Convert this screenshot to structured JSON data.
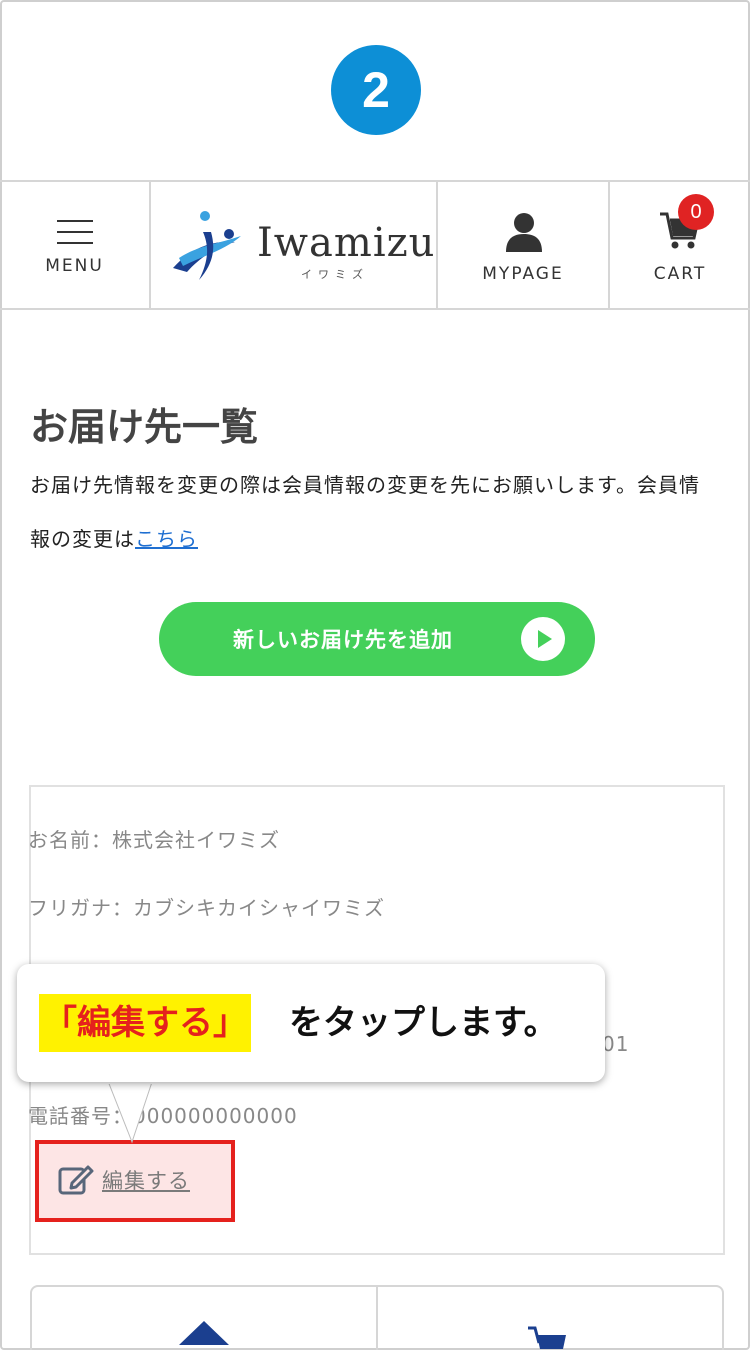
{
  "step_number": "2",
  "header": {
    "menu_label": "MENU",
    "logo_text": "Iwamizu",
    "logo_sub": "イワミズ",
    "mypage_label": "MYPAGE",
    "cart_label": "CART",
    "cart_count": "0"
  },
  "page": {
    "title": "お届け先一覧",
    "intro_text": "お届け先情報を変更の際は会員情報の変更を先にお願いします。会員情報の変更は",
    "intro_link": "こちら",
    "add_button_label": "新しいお届け先を追加"
  },
  "address_card": {
    "name_row": "お名前：株式会社イワミズ",
    "kana_row": "フリガナ：カブシキカイシャイワミズ",
    "address_fragment": "01",
    "phone_row": "電話番号：000000000000",
    "edit_label": "編集する"
  },
  "callout": {
    "highlight": "「編集する」",
    "rest": "をタップします。"
  },
  "colors": {
    "step_badge": "#0d8fd6",
    "add_button": "#44d05a",
    "cart_badge": "#e02323",
    "highlight_border": "#e5211d",
    "callout_highlight": "#fff200"
  }
}
